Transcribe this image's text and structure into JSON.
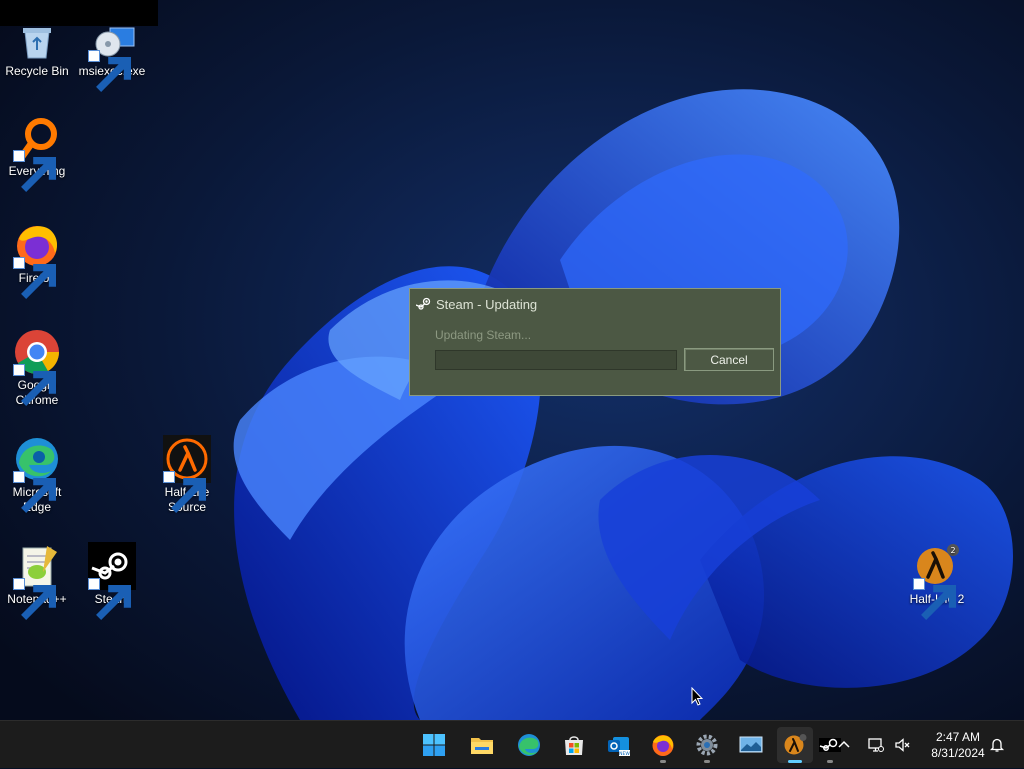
{
  "desktop": {
    "icons": [
      {
        "label": "Recycle Bin",
        "icon": "recycle-bin-icon"
      },
      {
        "label": "msiexec.exe",
        "icon": "installer-icon"
      },
      {
        "label": "Everything",
        "icon": "everything-search-icon"
      },
      {
        "label": "Firefox",
        "icon": "firefox-icon"
      },
      {
        "label": "Google Chrome",
        "icon": "chrome-icon"
      },
      {
        "label": "Microsoft Edge",
        "icon": "edge-icon"
      },
      {
        "label": "Half-Life Source",
        "icon": "half-life-source-icon"
      },
      {
        "label": "Notepad++",
        "icon": "notepad-plus-plus-icon"
      },
      {
        "label": "Steam",
        "icon": "steam-icon"
      },
      {
        "label": "Half-Life 2",
        "icon": "half-life-2-icon"
      }
    ]
  },
  "dialog": {
    "title": "Steam - Updating",
    "status": "Updating Steam...",
    "progress": 0,
    "cancel_label": "Cancel",
    "colors": {
      "background": "#4c5844",
      "border": "#8a9a80",
      "text": "#dde3d5"
    }
  },
  "taskbar": {
    "apps": [
      {
        "name": "start",
        "icon": "windows-start-icon"
      },
      {
        "name": "file-explorer",
        "icon": "folder-icon"
      },
      {
        "name": "edge",
        "icon": "edge-icon"
      },
      {
        "name": "microsoft-store",
        "icon": "store-icon"
      },
      {
        "name": "outlook",
        "icon": "outlook-new-icon"
      },
      {
        "name": "firefox",
        "icon": "firefox-icon"
      },
      {
        "name": "settings",
        "icon": "gear-icon"
      },
      {
        "name": "remote-desktop",
        "icon": "monitor-icon"
      },
      {
        "name": "half-life-2",
        "icon": "half-life-2-icon",
        "active": true
      },
      {
        "name": "steam",
        "icon": "steam-icon"
      }
    ],
    "clock": {
      "time": "2:47 AM",
      "date": "8/31/2024"
    }
  }
}
